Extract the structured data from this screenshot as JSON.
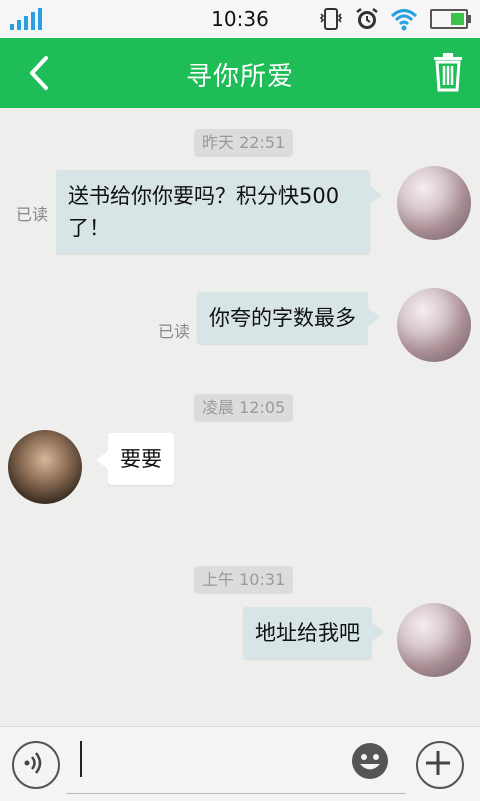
{
  "status_bar": {
    "time": "10:36"
  },
  "header": {
    "title": "寻你所爱"
  },
  "messages": [
    {
      "type": "timestamp",
      "text": "昨天 22:51"
    },
    {
      "type": "sent",
      "text": "送书给你你要吗？积分快500了！",
      "read": "已读"
    },
    {
      "type": "sent",
      "text": "你夸的字数最多",
      "read": "已读"
    },
    {
      "type": "timestamp",
      "text": "凌晨 12:05"
    },
    {
      "type": "received",
      "text": "要要"
    },
    {
      "type": "timestamp",
      "text": "上午 10:31"
    },
    {
      "type": "sent",
      "text": "地址给我吧"
    }
  ],
  "input": {
    "value": "",
    "placeholder": ""
  },
  "colors": {
    "header": "#1fbd57",
    "sent_bubble": "#d7e5e6",
    "received_bubble": "#ffffff",
    "background": "#eeeeec"
  },
  "icons": [
    "signal-icon",
    "vibrate-icon",
    "alarm-icon",
    "wifi-icon",
    "battery-icon",
    "back-arrow-icon",
    "trash-icon",
    "voice-icon",
    "emoji-icon",
    "plus-icon"
  ]
}
